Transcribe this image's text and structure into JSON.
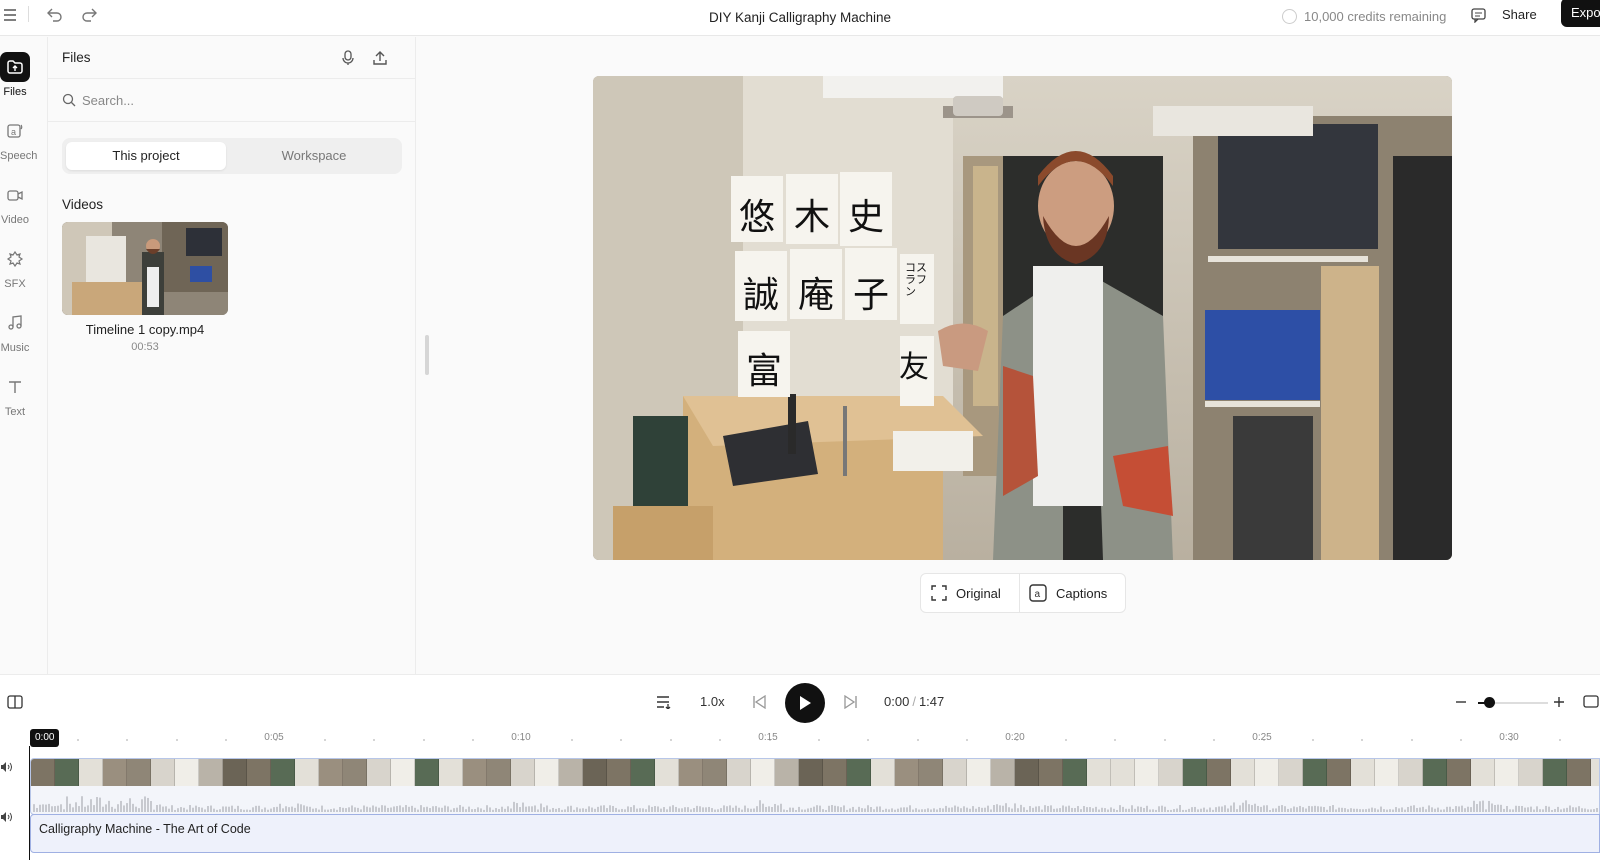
{
  "topbar": {
    "title": "DIY Kanji Calligraphy Machine",
    "credits": "10,000 credits remaining",
    "share_label": "Share",
    "export_label": "Expo"
  },
  "rail": {
    "items": [
      {
        "label": "Files",
        "icon": "files-icon",
        "active": true
      },
      {
        "label": "Speech",
        "icon": "speech-icon"
      },
      {
        "label": "Video",
        "icon": "video-icon"
      },
      {
        "label": "SFX",
        "icon": "sfx-icon"
      },
      {
        "label": "Music",
        "icon": "music-icon"
      },
      {
        "label": "Text",
        "icon": "text-icon"
      }
    ]
  },
  "panel": {
    "title": "Files",
    "search_placeholder": "Search...",
    "tabs": [
      "This project",
      "Workspace"
    ],
    "section_label": "Videos",
    "file": {
      "name": "Timeline 1 copy.mp4",
      "duration": "00:53"
    }
  },
  "preview": {
    "kanji": [
      "悠",
      "木",
      "史",
      "誠",
      "庵",
      "子",
      "コスラフン",
      "富",
      "友"
    ],
    "view_original": "Original",
    "view_captions": "Captions"
  },
  "transport": {
    "speed": "1.0x",
    "current_time": "0:00",
    "total_time": "1:47"
  },
  "timeline": {
    "playhead_label": "0:00",
    "ruler_labels": [
      "0:05",
      "0:10",
      "0:15",
      "0:20",
      "0:25",
      "0:30"
    ],
    "caption_clip": "Calligraphy Machine - The Art of Code"
  },
  "colors": {
    "accent": "#111111",
    "clip_border": "#9fb0e3",
    "clip_fill": "#eef1fb"
  }
}
